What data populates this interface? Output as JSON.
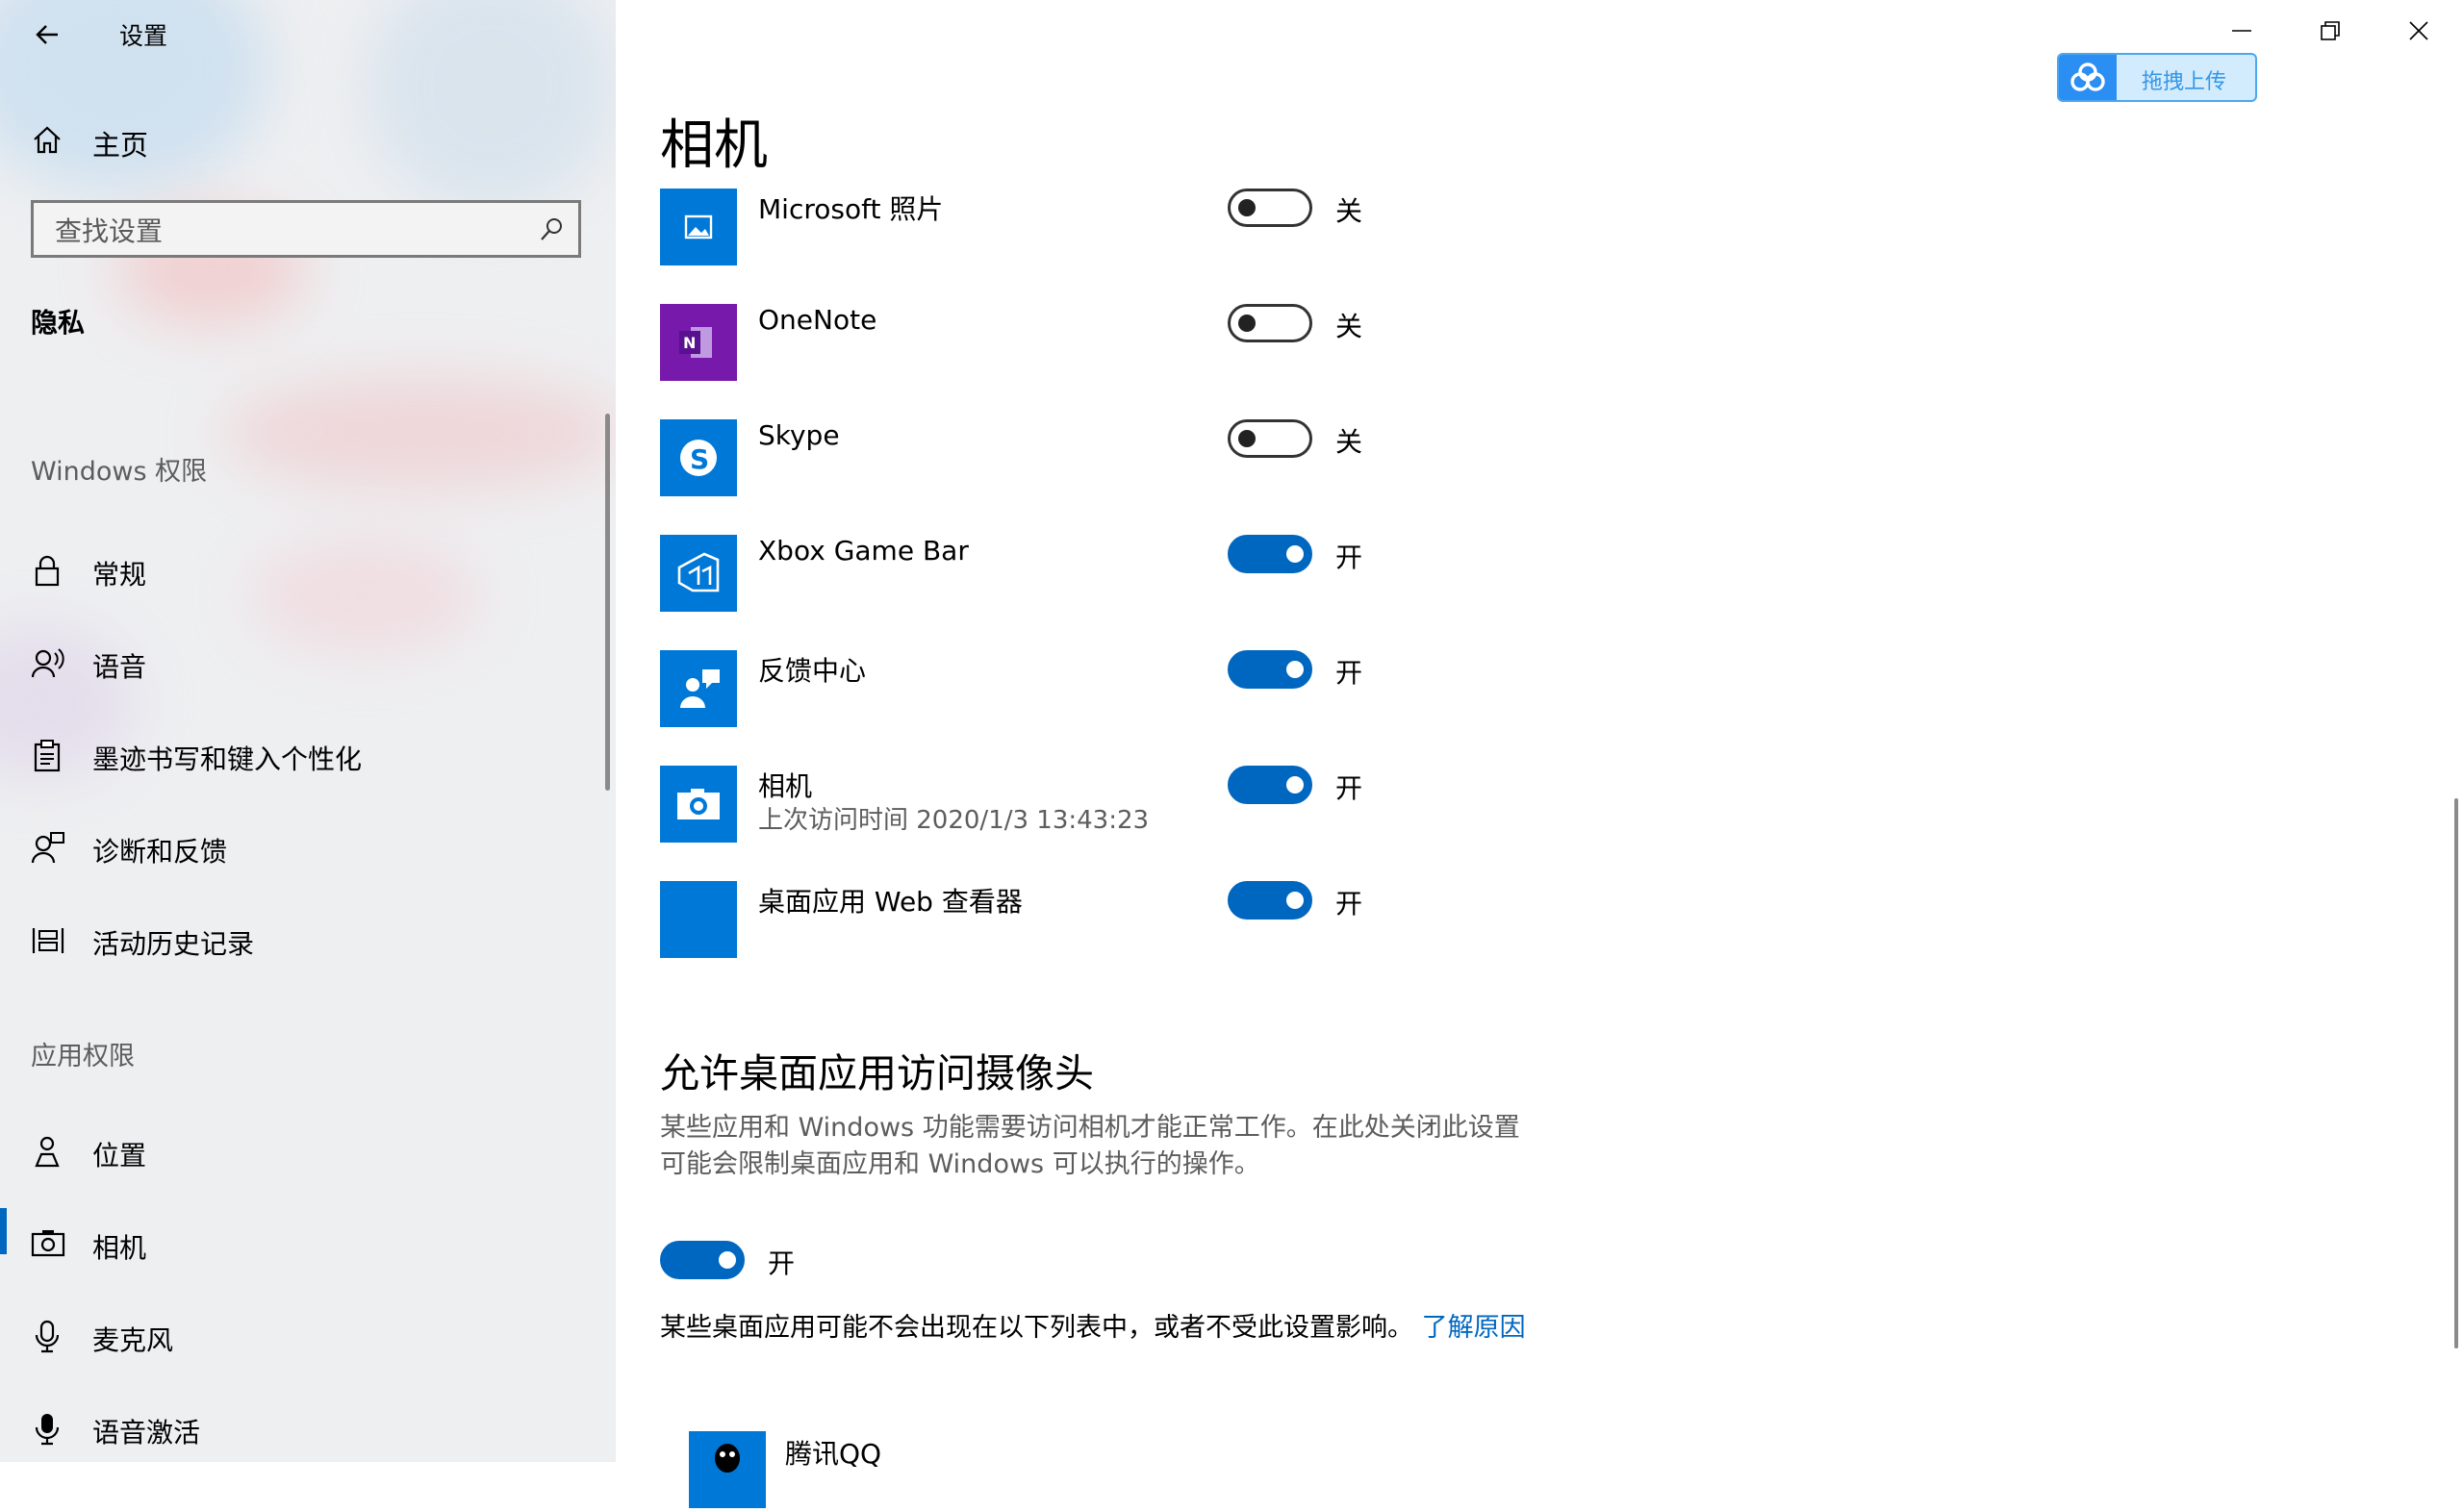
{
  "window": {
    "title": "设置"
  },
  "sidebar": {
    "home_label": "主页",
    "search_placeholder": "查找设置",
    "section_title": "隐私",
    "windows_group": "Windows 权限",
    "windows_items": [
      {
        "label": "常规",
        "icon": "lock-icon"
      },
      {
        "label": "语音",
        "icon": "speech-icon"
      },
      {
        "label": "墨迹书写和键入个性化",
        "icon": "clipboard-icon"
      },
      {
        "label": "诊断和反馈",
        "icon": "feedback-person-icon"
      },
      {
        "label": "活动历史记录",
        "icon": "timeline-icon"
      }
    ],
    "app_group": "应用权限",
    "app_items": [
      {
        "label": "位置",
        "icon": "location-icon"
      },
      {
        "label": "相机",
        "icon": "camera-icon",
        "active": true
      },
      {
        "label": "麦克风",
        "icon": "microphone-icon"
      },
      {
        "label": "语音激活",
        "icon": "voice-activation-icon"
      }
    ]
  },
  "main": {
    "page_title": "相机",
    "upload_label": "拖拽上传",
    "apps": [
      {
        "name": "Microsoft 照片",
        "state": "关",
        "on": false,
        "icon": "photos-icon",
        "color": "#0078d7"
      },
      {
        "name": "OneNote",
        "state": "关",
        "on": false,
        "icon": "onenote-icon",
        "color": "#7719aa"
      },
      {
        "name": "Skype",
        "state": "关",
        "on": false,
        "icon": "skype-icon",
        "color": "#0078d7"
      },
      {
        "name": "Xbox Game Bar",
        "state": "开",
        "on": true,
        "icon": "xbox-game-bar-icon",
        "color": "#0078d7"
      },
      {
        "name": "反馈中心",
        "state": "开",
        "on": true,
        "icon": "feedback-hub-icon",
        "color": "#0078d7"
      },
      {
        "name": "相机",
        "sub": "上次访问时间 2020/1/3 13:43:23",
        "state": "开",
        "on": true,
        "icon": "camera-app-icon",
        "color": "#0078d7"
      },
      {
        "name": "桌面应用 Web 查看器",
        "state": "开",
        "on": true,
        "icon": "web-viewer-icon",
        "color": "#0078d7"
      }
    ],
    "desktop_section": {
      "heading": "允许桌面应用访问摄像头",
      "description": "某些应用和 Windows 功能需要访问相机才能正常工作。在此处关闭此设置可能会限制桌面应用和 Windows 可以执行的操作。",
      "state": "开",
      "note": "某些桌面应用可能不会出现在以下列表中，或者不受此设置影响。",
      "learn_more": "了解原因"
    },
    "desktop_apps": [
      {
        "name": "腾讯QQ",
        "icon": "qq-icon"
      }
    ]
  },
  "colors": {
    "accent": "#0067c0",
    "toggle_on": "#0067c0",
    "onenote": "#7719aa",
    "tile": "#0078d7"
  }
}
